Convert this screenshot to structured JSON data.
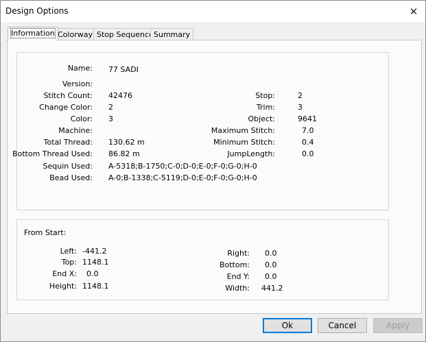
{
  "window": {
    "title": "Design Options",
    "close_glyph": "✕"
  },
  "tabs": [
    "Information",
    "Colorway",
    "Stop Sequence",
    "Summary"
  ],
  "info": {
    "name_label": "Name:",
    "name_value": "77 SADI",
    "version_label": "Version:",
    "version_value": "",
    "stitch_count_label": "Stitch Count:",
    "stitch_count_value": "42476",
    "change_color_label": "Change Color:",
    "change_color_value": "2",
    "color_label": "Color:",
    "color_value": "3",
    "machine_label": "Machine:",
    "machine_value": "",
    "total_thread_label": "Total Thread:",
    "total_thread_value": "130.62 m",
    "bottom_thread_label": "Bottom Thread Used:",
    "bottom_thread_value": "86.82 m",
    "sequin_label": "Sequin Used:",
    "sequin_value": "A-5318;B-1750;C-0;D-0;E-0;F-0;G-0;H-0",
    "bead_label": "Bead Used:",
    "bead_value": "A-0;B-1338;C-5119;D-0;E-0;F-0;G-0;H-0",
    "stop_label": "Stop:",
    "stop_value": "2",
    "trim_label": "Trim:",
    "trim_value": "3",
    "object_label": "Object:",
    "object_value": "9641",
    "max_stitch_label": "Maximum Stitch:",
    "max_stitch_value": "7.0",
    "min_stitch_label": "Minimum Stitch:",
    "min_stitch_value": "0.4",
    "jump_length_label": "JumpLength:",
    "jump_length_value": "0.0"
  },
  "from_start": {
    "heading": "From Start:",
    "left_label": "Left:",
    "left_value": "-441.2",
    "top_label": "Top:",
    "top_value": "1148.1",
    "endx_label": "End X:",
    "endx_value": "0.0",
    "height_label": "Height:",
    "height_value": "1148.1",
    "right_label": "Right:",
    "right_value": "0.0",
    "bottom_label": "Bottom:",
    "bottom_value": "0.0",
    "endy_label": "End Y:",
    "endy_value": "0.0",
    "width_label": "Width:",
    "width_value": "441.2"
  },
  "buttons": {
    "ok": "Ok",
    "cancel": "Cancel",
    "apply": "Apply"
  }
}
